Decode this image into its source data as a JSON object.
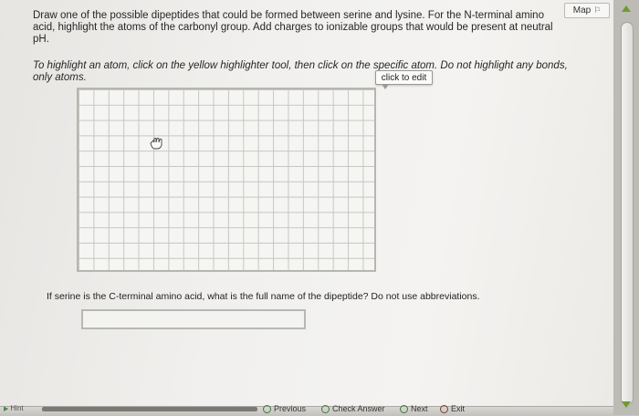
{
  "header": {
    "map_label": "Map",
    "map_icon": "signpost-icon"
  },
  "question": {
    "text": "Draw one of the possible dipeptides that could be formed between serine and lysine. For the N-terminal amino acid, highlight the atoms of the carbonyl group. Add charges to ionizable groups that would be present at neutral pH.",
    "instruction": "To highlight an atom, click on the yellow highlighter tool, then click on the specific atom. Do not highlight any bonds, only atoms."
  },
  "canvas": {
    "tooltip": "click to edit",
    "cursor_icon": "hand-pointer-icon"
  },
  "question2": {
    "text": "If serine is the C-terminal amino acid, what is the full name of the dipeptide? Do not use abbreviations.",
    "answer_value": "",
    "answer_placeholder": ""
  },
  "footer": {
    "hint_label": "Hint",
    "previous_label": "Previous",
    "check_answer_label": "Check Answer",
    "next_label": "Next",
    "exit_label": "Exit"
  },
  "colors": {
    "scroll_arrow": "#6d9b2e",
    "nav_icon": "#3c7a3c"
  }
}
